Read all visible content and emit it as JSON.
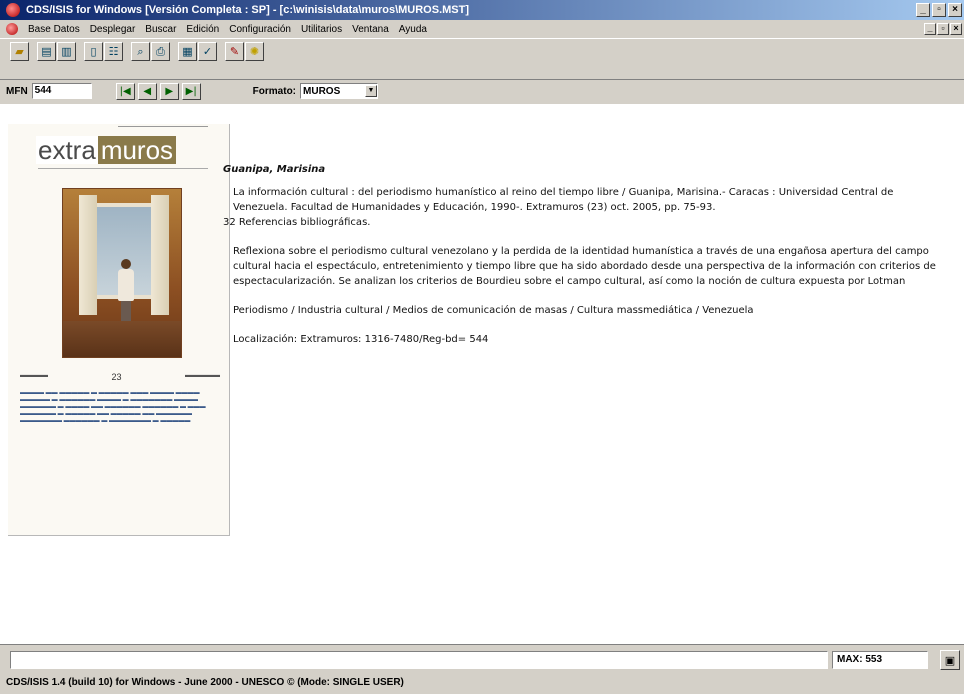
{
  "window": {
    "title": "CDS/ISIS for Windows [Versión Completa : SP] - [c:\\winisis\\data\\muros\\MUROS.MST]"
  },
  "menu": [
    "Base Datos",
    "Desplegar",
    "Buscar",
    "Edición",
    "Configuración",
    "Utilitarios",
    "Ventana",
    "Ayuda"
  ],
  "navbar": {
    "mfn_label": "MFN",
    "mfn_value": "544",
    "format_label": "Formato:",
    "format_value": "MUROS"
  },
  "cover": {
    "masthead_extra": "extra",
    "masthead_muros": "muros",
    "issue_number": "23"
  },
  "record": {
    "author": "Guanipa, Marisina",
    "citation": "La información cultural : del periodismo humanístico al reino del tiempo libre / Guanipa, Marisina.- Caracas : Universidad Central de Venezuela. Facultad de Humanidades y Educación, 1990-. Extramuros (23) oct. 2005, pp. 75-93.",
    "references": "32 Referencias bibliográficas.",
    "abstract": "Reflexiona sobre el periodismo cultural venezolano y la perdida de la identidad humanística a través de una engañosa apertura del campo cultural hacia el espectáculo, entretenimiento y tiempo libre que ha sido abordado desde una perspectiva de la información con criterios de espectacularización. Se analizan los criterios de Bourdieu sobre el campo cultural, así como la noción de cultura expuesta por Lotman",
    "descriptors": "Periodismo / Industria cultural / Medios de comunicación de masas / Cultura massmediática / Venezuela",
    "location": "Localización: Extramuros: 1316-7480/Reg-bd= 544"
  },
  "status": {
    "max_label": "MAX: 553",
    "footer": "CDS/ISIS 1.4 (build 10) for Windows - June 2000 - UNESCO © (Mode: SINGLE USER)"
  }
}
